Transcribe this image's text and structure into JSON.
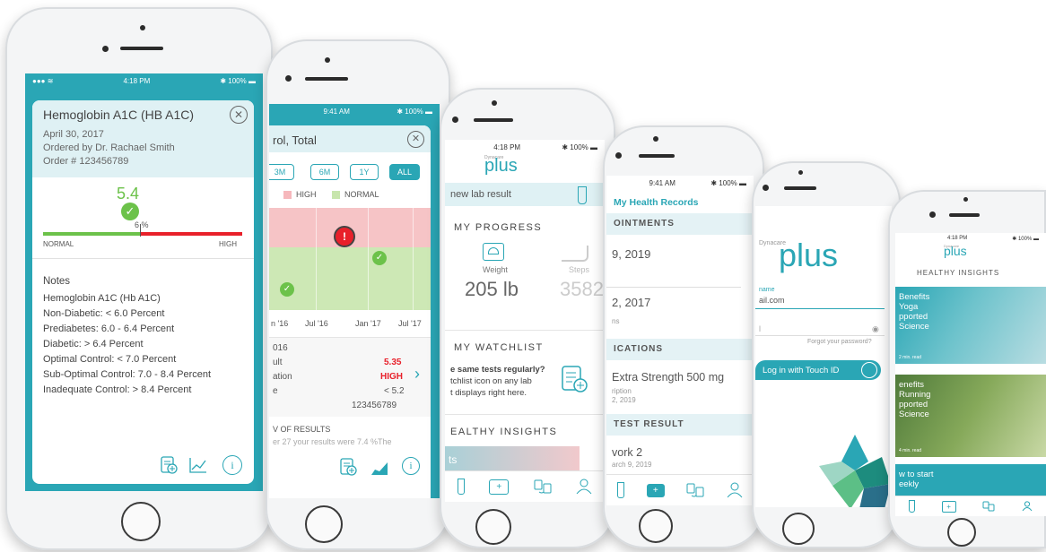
{
  "phone1": {
    "status_time": "4:18 PM",
    "status_battery": "100%",
    "card_title": "Hemoglobin A1C (HB A1C)",
    "date": "April 30, 2017",
    "ordered_by": "Ordered by Dr. Rachael Smith",
    "order_number": "Order # 123456789",
    "value": "5.4",
    "unit": "6 %",
    "range_low": "NORMAL",
    "range_high": "HIGH",
    "notes_title": "Notes",
    "notes": [
      "Hemoglobin A1C (Hb A1C)",
      "Non-Diabetic: < 6.0 Percent",
      "Prediabetes: 6.0 - 6.4 Percent",
      "Diabetic: > 6.4 Percent",
      "Optimal Control: < 7.0 Percent",
      "Sub-Optimal Control: 7.0 - 8.4 Percent",
      "Inadequate Control: > 8.4 Percent"
    ]
  },
  "phone2": {
    "status_time": "9:41 AM",
    "status_battery": "100%",
    "card_title": "rol, Total",
    "range_buttons": [
      "3M",
      "6M",
      "1Y",
      "ALL"
    ],
    "legend_high": "HIGH",
    "legend_normal": "NORMAL",
    "x_labels": [
      "n '16",
      "Jul '16",
      "Jan '17",
      "Jul '17"
    ],
    "detail_year": "016",
    "detail_rows": [
      {
        "label": "ult",
        "value": "5.35"
      },
      {
        "label": "ation",
        "value": "HIGH"
      },
      {
        "label": "e",
        "value": "< 5.2"
      },
      {
        "label": "",
        "value": "123456789"
      }
    ],
    "results_header": "V OF RESULTS",
    "results_text": "er 27 your results were 7.4 %The"
  },
  "phone3": {
    "status_time": "4:18 PM",
    "status_battery": "100%",
    "logo_small": "Dynacare",
    "logo": "plus",
    "banner": "new lab result",
    "progress_title": "MY PROGRESS",
    "weight_label": "Weight",
    "weight_value": "205 lb",
    "steps_label": "Steps",
    "steps_value": "3582",
    "watchlist_title": "MY WATCHLIST",
    "watchlist_bold": "e same tests regularly?",
    "watchlist_line1": "tchlist icon on any lab",
    "watchlist_line2": "t displays right here.",
    "insights_title": "EALTHY INSIGHTS",
    "insight_peek": "ts"
  },
  "phone4": {
    "status_time": "9:41 AM",
    "status_battery": "100%",
    "header": "My Health Records",
    "sec_appointments": "OINTMENTS",
    "appt1": "9, 2019",
    "appt2": "2, 2017",
    "appt2_sub": "ns",
    "sec_medications": "ICATIONS",
    "med_name": "Extra Strength 500 mg",
    "med_sub1": "ription",
    "med_sub2": "2, 2019",
    "sec_test": "TEST RESULT",
    "test_name": "vork 2",
    "test_date": "arch 9, 2019"
  },
  "phone5": {
    "logo_small": "Dynacare",
    "logo": "plus",
    "username_label": "name",
    "username_value": "ail.com",
    "password_placeholder": "l",
    "forgot": "Forgot your password?",
    "touch_id_button": "Log in with Touch ID"
  },
  "phone6": {
    "status_time": "4:18 PM",
    "status_battery": "100%",
    "logo_small": "Dynacare",
    "logo": "plus",
    "title": "HEALTHY INSIGHTS",
    "card1_lines": [
      "Benefits",
      "Yoga",
      "pported",
      "Science"
    ],
    "card1_time": "2 min. read",
    "card2_lines": [
      "enefits",
      "Running",
      "pported",
      "Science"
    ],
    "card2_time": "4 min. read",
    "card3_lines": [
      "w to start",
      "eekly"
    ]
  },
  "colors": {
    "teal": "#2aa6b5",
    "green": "#6cc24a",
    "red": "#e8202a",
    "light_teal": "#dff1f4"
  }
}
